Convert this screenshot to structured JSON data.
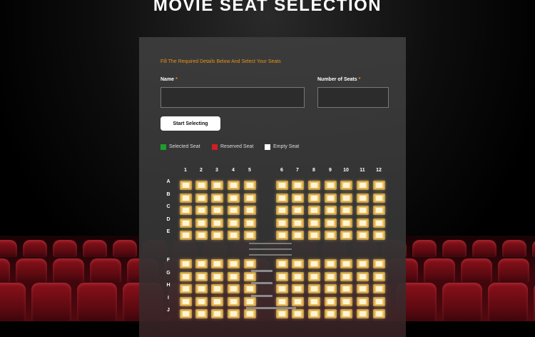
{
  "page": {
    "title": "MOVIE SEAT SELECTION"
  },
  "form": {
    "instructions": "Fill The Required Details Below And Select Your Seats",
    "name_label": "Name",
    "name_value": "",
    "seats_label": "Number of Seats",
    "seats_value": "",
    "required_mark": "*",
    "start_button_label": "Start Selecting"
  },
  "legend": {
    "selected": {
      "label": "Selected Seat",
      "color": "#1e9e2c"
    },
    "reserved": {
      "label": "Reserved Seat",
      "color": "#d01e24"
    },
    "empty": {
      "label": "Empty Seat",
      "color": "#ffffff"
    }
  },
  "seat_map": {
    "columns": [
      "1",
      "2",
      "3",
      "4",
      "5",
      "6",
      "7",
      "8",
      "9",
      "10",
      "11",
      "12"
    ],
    "rows_top": [
      "A",
      "B",
      "C",
      "D",
      "E"
    ],
    "rows_bottom": [
      "F",
      "G",
      "H",
      "I",
      "J"
    ],
    "seat_status": "empty",
    "seat_color": "#f3c76a"
  }
}
